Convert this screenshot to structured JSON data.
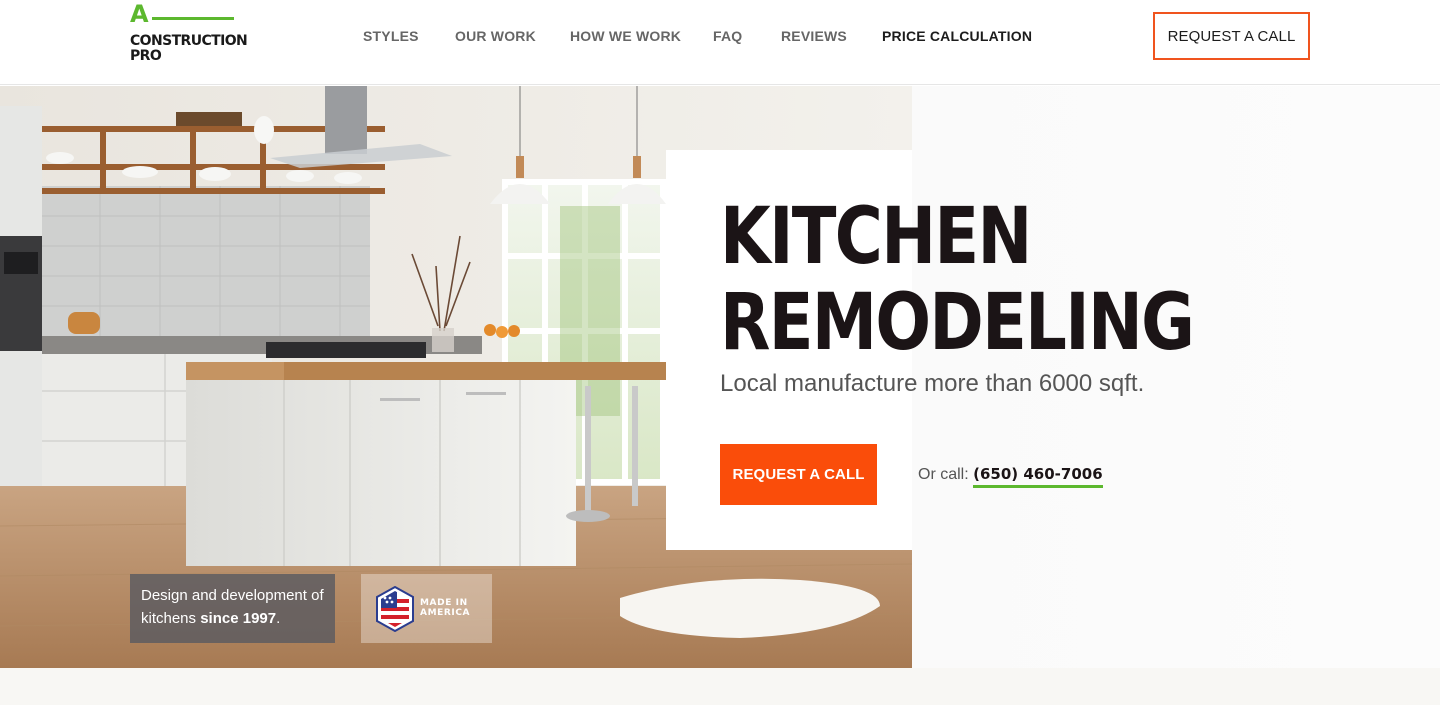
{
  "logo": {
    "mark": "A",
    "line1": "CONSTRUCTION",
    "line2": "PRO"
  },
  "nav": {
    "items": [
      {
        "label": "STYLES"
      },
      {
        "label": "OUR WORK"
      },
      {
        "label": "HOW WE WORK"
      },
      {
        "label": "FAQ"
      },
      {
        "label": "REVIEWS"
      },
      {
        "label": "PRICE CALCULATION"
      }
    ],
    "cta_label": "REQUEST A CALL"
  },
  "hero": {
    "title_line1": "KITCHEN",
    "title_line2": "REMODELING",
    "subtitle": "Local manufacture more than 6000 sqft.",
    "cta_label": "REQUEST A CALL",
    "or_call": "Or call:",
    "phone": "(650) 460-7006",
    "badge_text": "Design and development of kitchens",
    "badge_bold": "since 1997",
    "badge_end": ".",
    "america_line1": "MADE IN",
    "america_line2": "AMERICA"
  },
  "colors": {
    "accent_orange": "#fa4d0a",
    "accent_green": "#5cb82e",
    "text_dark": "#1b1416"
  },
  "icons": [
    "kitchen-photo",
    "usa-flag-hexagon-icon"
  ]
}
